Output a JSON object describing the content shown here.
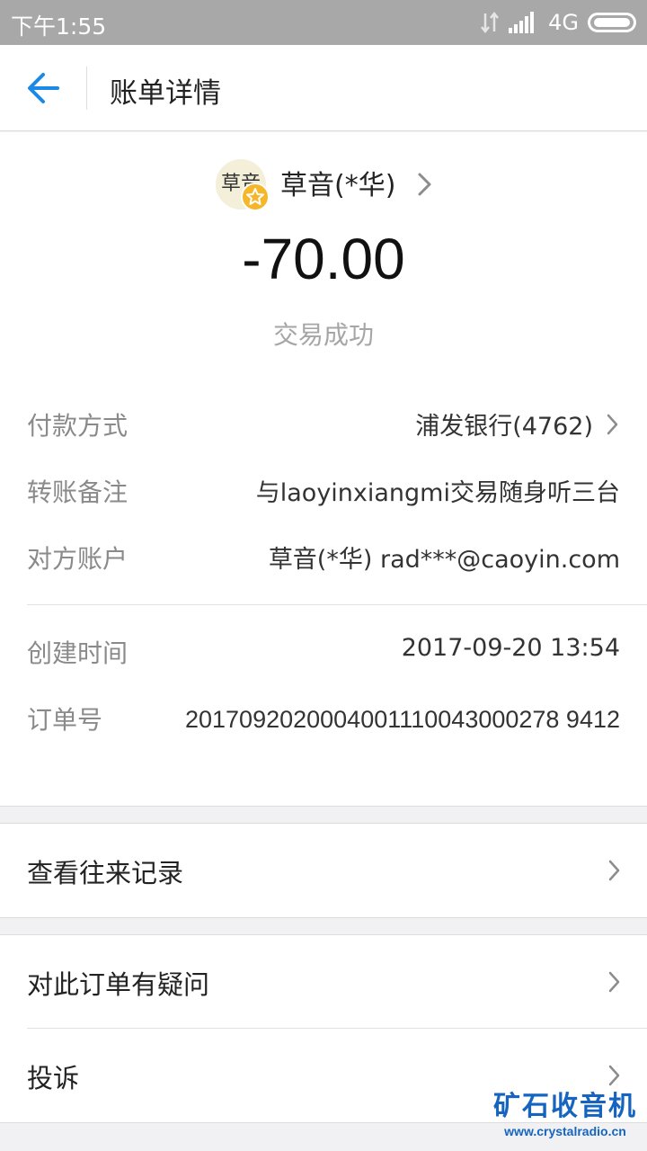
{
  "status_bar": {
    "time": "下午1:55",
    "network": "4G",
    "icons": [
      "data-transfer-icon",
      "signal-icon",
      "battery-icon"
    ]
  },
  "header": {
    "title": "账单详情",
    "back_icon": "back-arrow-icon",
    "accent_color": "#1a8ae6"
  },
  "merchant": {
    "avatar_text": "草音",
    "name": "草音(*华)",
    "badge_icon": "star-badge-icon",
    "badge_color": "#f5b62a"
  },
  "transaction": {
    "amount": "-70.00",
    "status": "交易成功"
  },
  "details": [
    {
      "label": "付款方式",
      "value": "浦发银行(4762)"
    },
    {
      "label": "转账备注",
      "value": "与laoyinxiangmi交易随身听三台"
    },
    {
      "label": "对方账户",
      "value": "草音(*华) rad***@caoyin.com"
    },
    {
      "label": "创建时间",
      "value": "2017-09-20 13:54"
    },
    {
      "label": "订单号",
      "value": "2017092020004001110043000278 9412"
    }
  ],
  "actions": [
    {
      "label": "查看往来记录"
    },
    {
      "label": "对此订单有疑问"
    },
    {
      "label": "投诉"
    }
  ],
  "watermark": {
    "brand": "矿石收音机",
    "url": "www.crystalradio.cn"
  }
}
